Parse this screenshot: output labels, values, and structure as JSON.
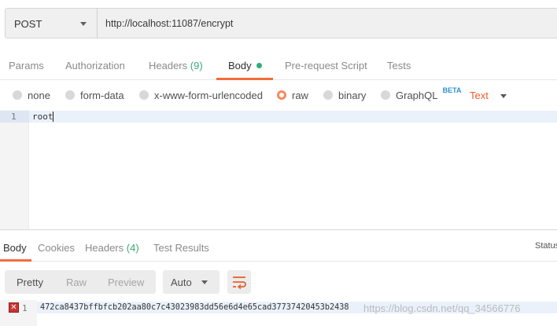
{
  "request": {
    "method": "POST",
    "url": "http://localhost:11087/encrypt"
  },
  "request_tabs": [
    {
      "label": "Params"
    },
    {
      "label": "Authorization"
    },
    {
      "label": "Headers",
      "count": "(9)"
    },
    {
      "label": "Body",
      "active": true
    },
    {
      "label": "Pre-request Script"
    },
    {
      "label": "Tests"
    }
  ],
  "body_types": [
    {
      "label": "none"
    },
    {
      "label": "form-data"
    },
    {
      "label": "x-www-form-urlencoded"
    },
    {
      "label": "raw",
      "checked": true
    },
    {
      "label": "binary"
    },
    {
      "label": "GraphQL",
      "badge": "BETA"
    }
  ],
  "content_type": "Text",
  "editor": {
    "lines": [
      {
        "num": "1",
        "text": "root"
      }
    ]
  },
  "response_tabs": [
    {
      "label": "Body",
      "active": true
    },
    {
      "label": "Cookies"
    },
    {
      "label": "Headers",
      "count": "(4)"
    },
    {
      "label": "Test Results"
    }
  ],
  "response_status_label": "Status",
  "view_modes": [
    {
      "label": "Pretty",
      "active": true
    },
    {
      "label": "Raw"
    },
    {
      "label": "Preview"
    }
  ],
  "format_select": "Auto",
  "response_lines": [
    {
      "num": "1",
      "text": "472ca8437bffbfcb202aa80c7c43023983dd56e6d4e65cad37737420453b2438"
    }
  ],
  "watermark": "https://blog.csdn.net/qq_34566776",
  "colors": {
    "accent": "#f26b3a",
    "active_dot": "#2bb07a",
    "beta": "#2a8fd8",
    "text_select": "#e8612c"
  },
  "icons": {
    "method_caret": "chevron-down-icon",
    "wrap": "wrap-lines-icon",
    "error": "error-x-icon"
  }
}
